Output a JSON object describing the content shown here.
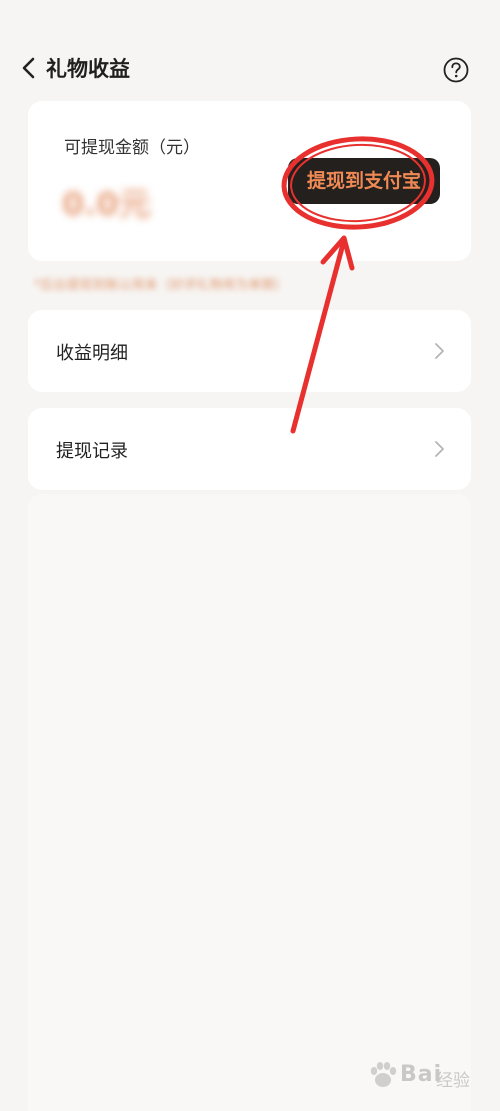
{
  "header": {
    "title": "礼物收益"
  },
  "balance": {
    "label": "可提现金额（元）",
    "amount": "0.0元",
    "withdraw_button": "提现到支付宝",
    "notice": "*后台提现到账以用来（好评礼物将为单期）"
  },
  "menu": [
    {
      "label": "收益明细"
    },
    {
      "label": "提现记录"
    }
  ],
  "colors": {
    "accent": "#f08a55",
    "button_bg": "#24201e",
    "annotation": "#e8312f",
    "background": "#f7f5f3"
  },
  "watermark": {
    "brand": "Bai",
    "sub": "经验"
  }
}
